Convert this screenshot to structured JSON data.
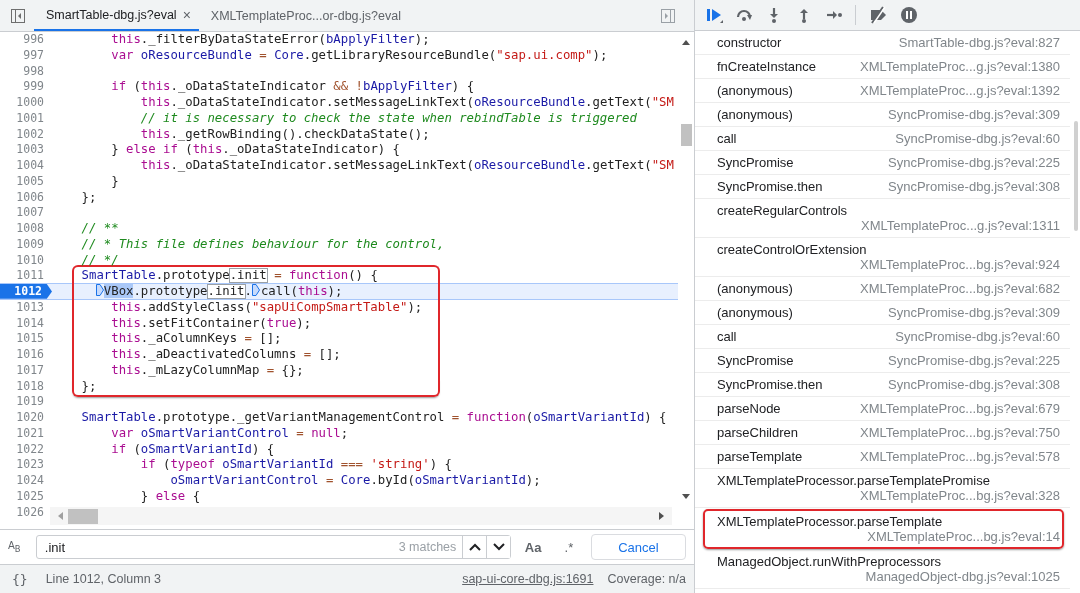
{
  "editor": {
    "tabs": [
      {
        "label": "SmartTable-dbg.js?eval",
        "selected": true,
        "close": "×"
      },
      {
        "label": "XMLTemplateProc...or-dbg.js?eval",
        "selected": false
      }
    ],
    "lines": [
      {
        "n": "996",
        "code": [
          {
            "kind": "k",
            "text": "        this"
          },
          {
            "kind": "p",
            "text": "._filterByDataStateError("
          },
          {
            "kind": "v",
            "text": "bApplyFilter"
          },
          {
            "kind": "p",
            "text": ");"
          }
        ]
      },
      {
        "n": "997",
        "code": [
          {
            "kind": "k",
            "text": "        var "
          },
          {
            "kind": "v",
            "text": "oResourceBundle "
          },
          {
            "kind": "o",
            "text": "= "
          },
          {
            "kind": "v",
            "text": "Core"
          },
          {
            "kind": "p",
            "text": ".getLibraryResourceBundle("
          },
          {
            "kind": "s",
            "text": "\"sap.ui.comp\""
          },
          {
            "kind": "p",
            "text": ");"
          }
        ]
      },
      {
        "n": "998"
      },
      {
        "n": "999",
        "code": [
          {
            "kind": "k",
            "text": "        if"
          },
          {
            "kind": "p",
            "text": " ("
          },
          {
            "kind": "k",
            "text": "this"
          },
          {
            "kind": "p",
            "text": "._oDataStateIndicator "
          },
          {
            "kind": "o",
            "text": "&& !"
          },
          {
            "kind": "v",
            "text": "bApplyFilter"
          },
          {
            "kind": "p",
            "text": ") {"
          }
        ]
      },
      {
        "n": "1000",
        "code": [
          {
            "kind": "k",
            "text": "            this"
          },
          {
            "kind": "p",
            "text": "._oDataStateIndicator.setMessageLinkText("
          },
          {
            "kind": "v",
            "text": "oResourceBundle"
          },
          {
            "kind": "p",
            "text": ".getText("
          },
          {
            "kind": "s",
            "text": "\"SM"
          }
        ]
      },
      {
        "n": "1001",
        "code": [
          {
            "kind": "c",
            "text": "            // it is necessary to check the state when rebindTable is triggered"
          }
        ]
      },
      {
        "n": "1002",
        "code": [
          {
            "kind": "k",
            "text": "            this"
          },
          {
            "kind": "p",
            "text": "._getRowBinding().checkDataState();"
          }
        ]
      },
      {
        "n": "1003",
        "code": [
          {
            "kind": "p",
            "text": "        } "
          },
          {
            "kind": "k",
            "text": "else if"
          },
          {
            "kind": "p",
            "text": " ("
          },
          {
            "kind": "k",
            "text": "this"
          },
          {
            "kind": "p",
            "text": "._oDataStateIndicator) {"
          }
        ]
      },
      {
        "n": "1004",
        "code": [
          {
            "kind": "k",
            "text": "            this"
          },
          {
            "kind": "p",
            "text": "._oDataStateIndicator.setMessageLinkText("
          },
          {
            "kind": "v",
            "text": "oResourceBundle"
          },
          {
            "kind": "p",
            "text": ".getText("
          },
          {
            "kind": "s",
            "text": "\"SM"
          }
        ]
      },
      {
        "n": "1005",
        "code": [
          {
            "kind": "p",
            "text": "        }"
          }
        ]
      },
      {
        "n": "1006",
        "code": [
          {
            "kind": "p",
            "text": "    };"
          }
        ]
      },
      {
        "n": "1007"
      },
      {
        "n": "1008",
        "code": [
          {
            "kind": "c",
            "text": "    // **"
          }
        ]
      },
      {
        "n": "1009",
        "code": [
          {
            "kind": "c",
            "text": "    // * This file defines behaviour for the control,"
          }
        ]
      },
      {
        "n": "1010",
        "code": [
          {
            "kind": "c",
            "text": "    // */"
          }
        ]
      },
      {
        "n": "1011",
        "boxed": true,
        "code": [
          {
            "kind": "v",
            "text": "    SmartTable"
          },
          {
            "kind": "p",
            "text": ".prototype"
          },
          {
            "kind": "m",
            "text": ".init"
          },
          {
            "kind": "o",
            "text": " = "
          },
          {
            "kind": "k",
            "text": "function"
          },
          {
            "kind": "p",
            "text": "() {"
          }
        ]
      },
      {
        "n": "1012",
        "boxed": true,
        "current": true,
        "code": [
          {
            "kind": "sel",
            "text": "       VBox",
            "breakpoint": true
          },
          {
            "kind": "p",
            "text": ".prototype"
          },
          {
            "kind": "m",
            "text": ".init"
          },
          {
            "kind": "p",
            "text": "."
          },
          {
            "kind": "p",
            "text": "call(",
            "breakpoint": true
          },
          {
            "kind": "k",
            "text": "this"
          },
          {
            "kind": "p",
            "text": ");"
          }
        ]
      },
      {
        "n": "1013",
        "boxed": true,
        "code": [
          {
            "kind": "k",
            "text": "        this"
          },
          {
            "kind": "p",
            "text": ".addStyleClass("
          },
          {
            "kind": "s",
            "text": "\"sapUiCompSmartTable\""
          },
          {
            "kind": "p",
            "text": ");"
          }
        ]
      },
      {
        "n": "1014",
        "boxed": true,
        "code": [
          {
            "kind": "k",
            "text": "        this"
          },
          {
            "kind": "p",
            "text": ".setFitContainer("
          },
          {
            "kind": "k",
            "text": "true"
          },
          {
            "kind": "p",
            "text": ");"
          }
        ]
      },
      {
        "n": "1015",
        "boxed": true,
        "code": [
          {
            "kind": "k",
            "text": "        this"
          },
          {
            "kind": "p",
            "text": "._aColumnKeys "
          },
          {
            "kind": "o",
            "text": "="
          },
          {
            "kind": "p",
            "text": " [];"
          }
        ]
      },
      {
        "n": "1016",
        "boxed": true,
        "code": [
          {
            "kind": "k",
            "text": "        this"
          },
          {
            "kind": "p",
            "text": "._aDeactivatedColumns "
          },
          {
            "kind": "o",
            "text": "="
          },
          {
            "kind": "p",
            "text": " [];"
          }
        ]
      },
      {
        "n": "1017",
        "boxed": true,
        "code": [
          {
            "kind": "k",
            "text": "        this"
          },
          {
            "kind": "p",
            "text": "._mLazyColumnMap "
          },
          {
            "kind": "o",
            "text": "="
          },
          {
            "kind": "p",
            "text": " {};"
          }
        ]
      },
      {
        "n": "1018",
        "boxed": true,
        "code": [
          {
            "kind": "p",
            "text": "    };"
          }
        ]
      },
      {
        "n": "1019"
      },
      {
        "n": "1020",
        "code": [
          {
            "kind": "v",
            "text": "    SmartTable"
          },
          {
            "kind": "p",
            "text": ".prototype._getVariantManagementControl "
          },
          {
            "kind": "o",
            "text": "= "
          },
          {
            "kind": "k",
            "text": "function"
          },
          {
            "kind": "p",
            "text": "("
          },
          {
            "kind": "v",
            "text": "oSmartVariantId"
          },
          {
            "kind": "p",
            "text": ") {"
          }
        ]
      },
      {
        "n": "1021",
        "code": [
          {
            "kind": "k",
            "text": "        var "
          },
          {
            "kind": "v",
            "text": "oSmartVariantControl "
          },
          {
            "kind": "o",
            "text": "= "
          },
          {
            "kind": "k",
            "text": "null"
          },
          {
            "kind": "p",
            "text": ";"
          }
        ]
      },
      {
        "n": "1022",
        "code": [
          {
            "kind": "k",
            "text": "        if"
          },
          {
            "kind": "p",
            "text": " ("
          },
          {
            "kind": "v",
            "text": "oSmartVariantId"
          },
          {
            "kind": "p",
            "text": ") {"
          }
        ]
      },
      {
        "n": "1023",
        "code": [
          {
            "kind": "k",
            "text": "            if"
          },
          {
            "kind": "p",
            "text": " ("
          },
          {
            "kind": "k",
            "text": "typeof "
          },
          {
            "kind": "v",
            "text": "oSmartVariantId "
          },
          {
            "kind": "o",
            "text": "=== "
          },
          {
            "kind": "s",
            "text": "'string'"
          },
          {
            "kind": "p",
            "text": ") {"
          }
        ]
      },
      {
        "n": "1024",
        "code": [
          {
            "kind": "v",
            "text": "                oSmartVariantControl "
          },
          {
            "kind": "o",
            "text": "= "
          },
          {
            "kind": "v",
            "text": "Core"
          },
          {
            "kind": "p",
            "text": ".byId("
          },
          {
            "kind": "v",
            "text": "oSmartVariantId"
          },
          {
            "kind": "p",
            "text": ");"
          }
        ]
      },
      {
        "n": "1025",
        "code": [
          {
            "kind": "p",
            "text": "            } "
          },
          {
            "kind": "k",
            "text": "else"
          },
          {
            "kind": "p",
            "text": " {"
          }
        ]
      },
      {
        "n": "1026"
      }
    ],
    "search": {
      "replace_label": "A$_{B}$",
      "value": ".init",
      "matches": "3 matches",
      "case_label": "Aa",
      "regex_label": ".*",
      "cancel": "Cancel"
    },
    "status_bar": {
      "format_label": "{}",
      "position": "Line 1012, Column 3",
      "source_link": "sap-ui-core-dbg.js:1691",
      "coverage": "Coverage: n/a"
    }
  },
  "call_stack": [
    {
      "name": "constructor",
      "location": "SmartTable-dbg.js?eval:827"
    },
    {
      "name": "fnCreateInstance",
      "location": "XMLTemplateProc...g.js?eval:1380"
    },
    {
      "name": "(anonymous)",
      "location": "XMLTemplateProc...g.js?eval:1392"
    },
    {
      "name": "(anonymous)",
      "location": "SyncPromise-dbg.js?eval:309"
    },
    {
      "name": "call",
      "location": "SyncPromise-dbg.js?eval:60"
    },
    {
      "name": "SyncPromise",
      "location": "SyncPromise-dbg.js?eval:225"
    },
    {
      "name": "SyncPromise.then",
      "location": "SyncPromise-dbg.js?eval:308"
    },
    {
      "name": "createRegularControls",
      "location": "XMLTemplateProc...g.js?eval:1311"
    },
    {
      "name": "createControlOrExtension",
      "location": "XMLTemplateProc...bg.js?eval:924"
    },
    {
      "name": "(anonymous)",
      "location": "XMLTemplateProc...bg.js?eval:682"
    },
    {
      "name": "(anonymous)",
      "location": "SyncPromise-dbg.js?eval:309"
    },
    {
      "name": "call",
      "location": "SyncPromise-dbg.js?eval:60"
    },
    {
      "name": "SyncPromise",
      "location": "SyncPromise-dbg.js?eval:225"
    },
    {
      "name": "SyncPromise.then",
      "location": "SyncPromise-dbg.js?eval:308"
    },
    {
      "name": "parseNode",
      "location": "XMLTemplateProc...bg.js?eval:679"
    },
    {
      "name": "parseChildren",
      "location": "XMLTemplateProc...bg.js?eval:750"
    },
    {
      "name": "parseTemplate",
      "location": "XMLTemplateProc...bg.js?eval:578"
    },
    {
      "name": "XMLTemplateProcessor.parseTemplatePromise",
      "location": "XMLTemplateProc...bg.js?eval:328"
    },
    {
      "name": "XMLTemplateProcessor.parseTemplate",
      "location": "XMLTemplateProc...bg.js?eval:14",
      "boxed": true
    },
    {
      "name": "ManagedObject.runWithPreprocessors",
      "location": "ManagedObject-dbg.js?eval:1025"
    }
  ]
}
